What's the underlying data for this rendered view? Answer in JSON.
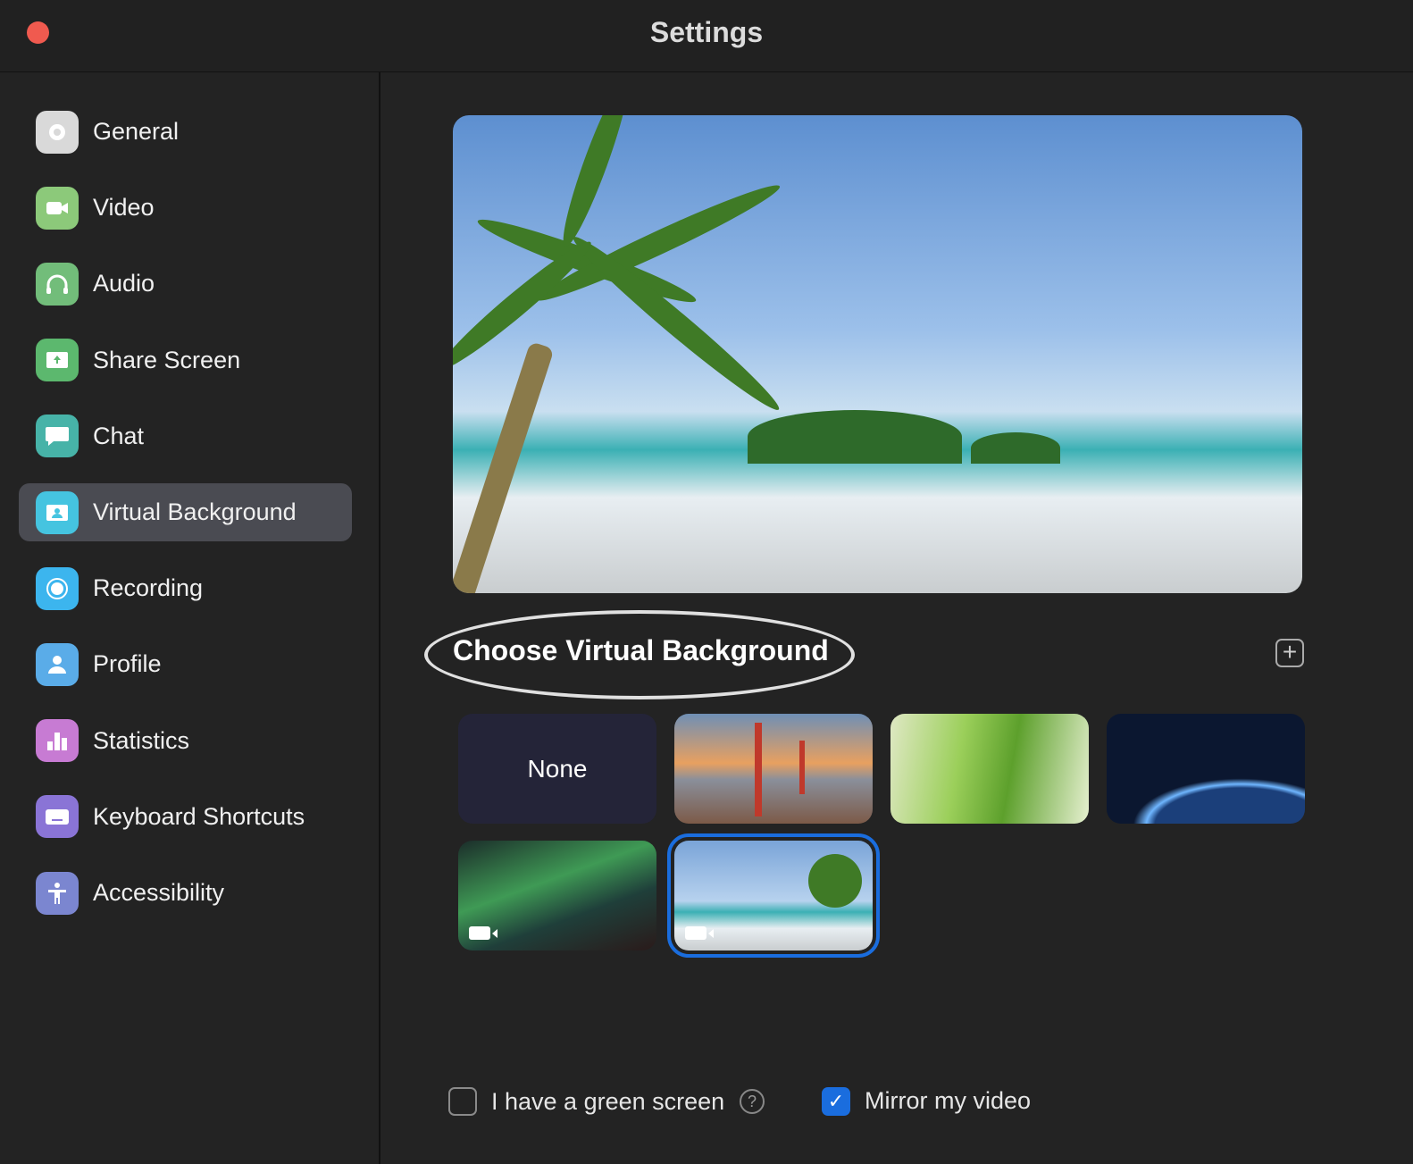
{
  "window": {
    "title": "Settings"
  },
  "sidebar": {
    "items": [
      {
        "label": "General",
        "icon": "gear-icon",
        "color": "#d9d9d9"
      },
      {
        "label": "Video",
        "icon": "video-camera-icon",
        "color": "#8cc97a"
      },
      {
        "label": "Audio",
        "icon": "headphones-icon",
        "color": "#72bd7a"
      },
      {
        "label": "Share Screen",
        "icon": "share-screen-icon",
        "color": "#5cb86e"
      },
      {
        "label": "Chat",
        "icon": "chat-bubble-icon",
        "color": "#47b3a8"
      },
      {
        "label": "Virtual Background",
        "icon": "virtual-background-icon",
        "color": "#45c4e0",
        "active": true
      },
      {
        "label": "Recording",
        "icon": "record-icon",
        "color": "#3cb5ee"
      },
      {
        "label": "Profile",
        "icon": "profile-icon",
        "color": "#5aace8"
      },
      {
        "label": "Statistics",
        "icon": "statistics-icon",
        "color": "#c77bd3"
      },
      {
        "label": "Keyboard Shortcuts",
        "icon": "keyboard-icon",
        "color": "#8a74d6"
      },
      {
        "label": "Accessibility",
        "icon": "accessibility-icon",
        "color": "#7b86d0"
      }
    ]
  },
  "main": {
    "heading": "Choose Virtual Background",
    "add_label": "+",
    "backgrounds": [
      {
        "label": "None",
        "selected": false
      },
      {
        "name": "golden-gate-bridge",
        "selected": false
      },
      {
        "name": "grass",
        "selected": false
      },
      {
        "name": "earth-from-space",
        "selected": false
      },
      {
        "name": "aurora",
        "video": true,
        "selected": false
      },
      {
        "name": "beach-palm",
        "video": true,
        "selected": true
      }
    ],
    "green_screen": {
      "label": "I have a green screen",
      "checked": false,
      "help": "?"
    },
    "mirror": {
      "label": "Mirror my video",
      "checked": true,
      "check": "✓"
    },
    "accent": "#1a6dde"
  }
}
